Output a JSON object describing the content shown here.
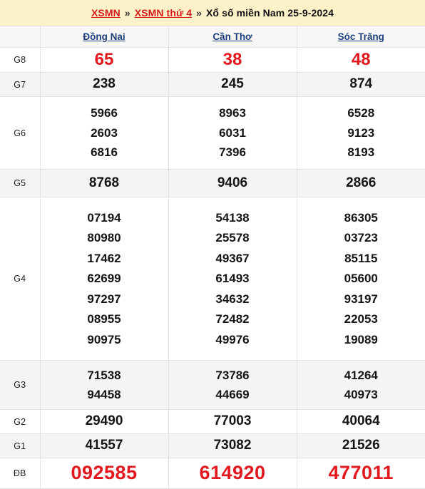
{
  "banner": {
    "link1": "XSMN",
    "sep1": "»",
    "link2": "XSMN thứ 4",
    "sep2": "»",
    "title": "Xổ số miền Nam 25-9-2024",
    "background_color": "#fdf1c9",
    "link_color": "#d61a1a"
  },
  "table": {
    "label_header": "",
    "provinces": [
      {
        "name": "Đồng Nai"
      },
      {
        "name": "Cần Thơ"
      },
      {
        "name": "Sóc Trăng"
      }
    ],
    "province_link_color": "#1f3f7a",
    "highlight_color": "#e2181f",
    "rows": [
      {
        "label": "G8",
        "style": "red-large",
        "values": [
          [
            "65"
          ],
          [
            "38"
          ],
          [
            "48"
          ]
        ]
      },
      {
        "label": "G7",
        "style": "shaded",
        "values": [
          [
            "238"
          ],
          [
            "245"
          ],
          [
            "874"
          ]
        ]
      },
      {
        "label": "G6",
        "style": "plain",
        "values": [
          [
            "5966",
            "2603",
            "6816"
          ],
          [
            "8963",
            "6031",
            "7396"
          ],
          [
            "6528",
            "9123",
            "8193"
          ]
        ]
      },
      {
        "label": "G5",
        "style": "shaded",
        "values": [
          [
            "8768"
          ],
          [
            "9406"
          ],
          [
            "2866"
          ]
        ]
      },
      {
        "label": "G4",
        "style": "plain",
        "values": [
          [
            "07194",
            "80980",
            "17462",
            "62699",
            "97297",
            "08955",
            "90975"
          ],
          [
            "54138",
            "25578",
            "49367",
            "61493",
            "34632",
            "72482",
            "49976"
          ],
          [
            "86305",
            "03723",
            "85115",
            "05600",
            "93197",
            "22053",
            "19089"
          ]
        ]
      },
      {
        "label": "G3",
        "style": "shaded",
        "values": [
          [
            "71538",
            "94458"
          ],
          [
            "73786",
            "44669"
          ],
          [
            "41264",
            "40973"
          ]
        ]
      },
      {
        "label": "G2",
        "style": "plain",
        "values": [
          [
            "29490"
          ],
          [
            "77003"
          ],
          [
            "40064"
          ]
        ]
      },
      {
        "label": "G1",
        "style": "shaded",
        "values": [
          [
            "41557"
          ],
          [
            "73082"
          ],
          [
            "21526"
          ]
        ]
      },
      {
        "label": "ĐB",
        "style": "red-xlarge",
        "values": [
          [
            "092585"
          ],
          [
            "614920"
          ],
          [
            "477011"
          ]
        ]
      }
    ]
  }
}
